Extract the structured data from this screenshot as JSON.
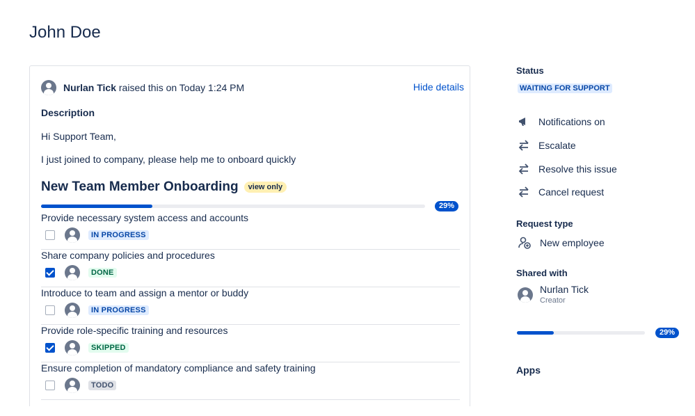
{
  "page": {
    "title": "John Doe"
  },
  "request": {
    "reporter": "Nurlan Tick",
    "raised_text": " raised this on Today 1:24 PM",
    "hide_details": "Hide details",
    "description_label": "Description",
    "description_lines": [
      "Hi Support Team,",
      "I just joined to company, please help me to onboard quickly"
    ]
  },
  "checklist": {
    "title": "New Team Member Onboarding",
    "badge": "view only",
    "progress_percent": 29,
    "progress_label": "29%",
    "items": [
      {
        "text": "Provide necessary system access and accounts",
        "checked": false,
        "status": "IN PROGRESS"
      },
      {
        "text": "Share company policies and procedures",
        "checked": true,
        "status": "DONE"
      },
      {
        "text": "Introduce to team and assign a mentor or buddy",
        "checked": false,
        "status": "IN PROGRESS"
      },
      {
        "text": "Provide role-specific training and resources",
        "checked": true,
        "status": "SKIPPED"
      },
      {
        "text": "Ensure completion of mandatory compliance and safety training",
        "checked": false,
        "status": "TODO"
      }
    ]
  },
  "sidebar": {
    "status_label": "Status",
    "status_value": "WAITING FOR SUPPORT",
    "actions": [
      {
        "label": "Notifications on",
        "icon": "megaphone-icon"
      },
      {
        "label": "Escalate",
        "icon": "transition-arrows-icon"
      },
      {
        "label": "Resolve this issue",
        "icon": "transition-arrows-icon"
      },
      {
        "label": "Cancel request",
        "icon": "transition-arrows-icon"
      }
    ],
    "request_type_label": "Request type",
    "request_type_value": "New employee",
    "shared_with_label": "Shared with",
    "shared_name": "Nurlan Tick",
    "shared_role": "Creator",
    "progress_percent": 29,
    "progress_label": "29%",
    "apps_label": "Apps"
  },
  "colors": {
    "accent": "#0052cc",
    "text": "#172b4d",
    "muted": "#6b778c"
  }
}
